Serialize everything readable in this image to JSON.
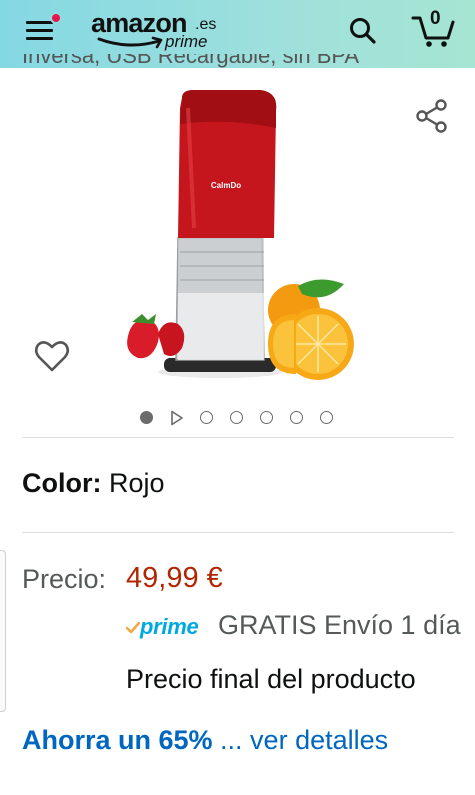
{
  "header": {
    "logo_word": "amazon",
    "logo_tld": ".es",
    "logo_sub": "prime",
    "cart_count": "0",
    "menu_icon": "hamburger-menu-icon",
    "search_icon": "search-icon",
    "cart_icon": "cart-icon",
    "notification_color": "#e3174e",
    "header_gradient": [
      "#84d8e3",
      "#a6e5d2"
    ]
  },
  "product": {
    "title_cut": "Inversa, USB Recargable, sin BPA",
    "image_brand": "CalmDo",
    "image_icon": "juicer-product-image",
    "share_icon": "share-icon",
    "wishlist_icon": "heart-icon",
    "carousel": {
      "count": 7,
      "active_index": 0,
      "video_index": 1
    }
  },
  "variant": {
    "label": "Color:",
    "value": "Rojo"
  },
  "pricing": {
    "label": "Precio:",
    "value": "49,99 €",
    "price_color": "#b12704",
    "prime_label": "prime",
    "shipping": "GRATIS Envío 1 día",
    "final_note": "Precio final del producto",
    "savings_strong": "Ahorra un 65%",
    "savings_link": " ... ver detalles",
    "link_color": "#0066c0"
  }
}
